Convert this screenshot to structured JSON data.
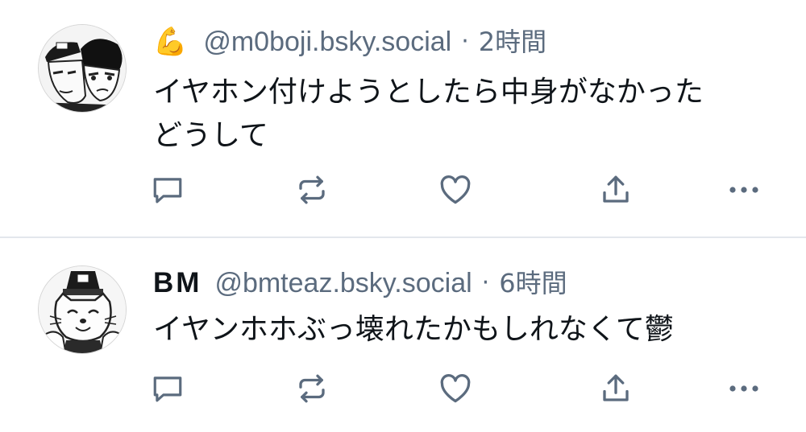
{
  "posts": [
    {
      "display_name": "",
      "name_emoji": "💪",
      "handle": "@m0boji.bsky.social",
      "separator": "·",
      "time": "2時間",
      "text_lines": [
        "イヤホン付けようとしたら中身がなかった",
        "どうして"
      ],
      "avatar": "manga-characters-avatar",
      "actions": [
        "reply-icon",
        "repost-icon",
        "like-icon",
        "share-icon",
        "more-icon"
      ]
    },
    {
      "display_name": "BM",
      "name_emoji": "",
      "handle": "@bmteaz.bsky.social",
      "separator": "·",
      "time": "6時間",
      "text_lines": [
        "イヤンホホぶっ壊れたかもしれなくて鬱"
      ],
      "avatar": "manga-officer-avatar",
      "actions": [
        "reply-icon",
        "repost-icon",
        "like-icon",
        "share-icon",
        "more-icon"
      ]
    }
  ],
  "colors": {
    "text": "#0f1419",
    "meta": "#5b6b7e",
    "icon": "#5b6b7e",
    "divider": "#e3e7ec"
  }
}
